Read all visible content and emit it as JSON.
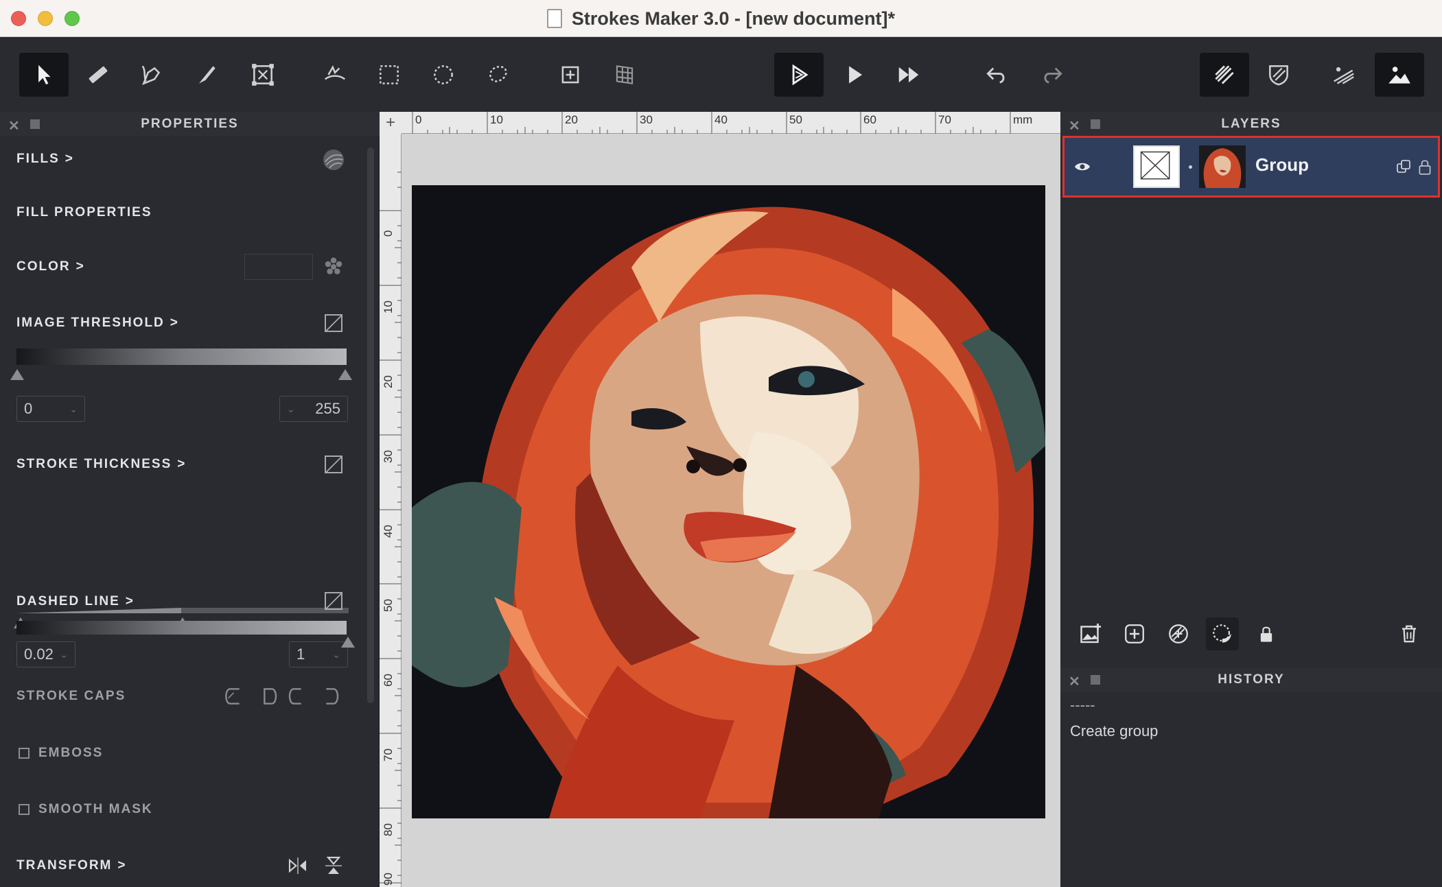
{
  "window": {
    "title": "Strokes Maker 3.0 - [new document]*"
  },
  "toolbar": {
    "tools": [
      {
        "name": "select-tool",
        "icon": "arrow-pointer-icon"
      },
      {
        "name": "ruler-tool",
        "icon": "ruler-icon"
      },
      {
        "name": "pen-tool",
        "icon": "pen-nib-icon"
      },
      {
        "name": "brush-tool",
        "icon": "brush-icon"
      },
      {
        "name": "transform-tool",
        "icon": "transform-box-icon"
      },
      {
        "name": "stroke-direction-tool",
        "icon": "hand-stroke-icon"
      },
      {
        "name": "rect-select-tool",
        "icon": "rect-select-icon"
      },
      {
        "name": "ellipse-select-tool",
        "icon": "ellipse-select-icon"
      },
      {
        "name": "lasso-tool",
        "icon": "lasso-icon"
      },
      {
        "name": "crop-tool",
        "icon": "crop-icon"
      },
      {
        "name": "grid-tool",
        "icon": "grid-warp-icon"
      },
      {
        "name": "render-button",
        "icon": "play-outline-icon"
      },
      {
        "name": "play-button",
        "icon": "play-icon"
      },
      {
        "name": "fast-forward-button",
        "icon": "fast-forward-icon"
      },
      {
        "name": "undo-button",
        "icon": "undo-icon"
      },
      {
        "name": "redo-button",
        "icon": "redo-icon"
      },
      {
        "name": "view-strokes-button",
        "icon": "strokes-view-icon"
      },
      {
        "name": "view-shield-button",
        "icon": "shield-stripes-icon"
      },
      {
        "name": "view-mixed-button",
        "icon": "landscape-strokes-icon"
      },
      {
        "name": "view-image-button",
        "icon": "landscape-image-icon"
      }
    ]
  },
  "properties": {
    "panel_title": "PROPERTIES",
    "fills_label": "FILLS",
    "fill_properties_label": "FILL PROPERTIES",
    "color_label": "COLOR",
    "image_threshold_label": "IMAGE THRESHOLD",
    "threshold_min": "0",
    "threshold_max": "255",
    "stroke_thickness_label": "STROKE THICKNESS",
    "thickness_min": "0.02",
    "thickness_max": "1",
    "dashed_line_label": "DASHED LINE",
    "stroke_caps_label": "STROKE CAPS",
    "emboss_label": "EMBOSS",
    "smooth_mask_label": "SMOOTH MASK",
    "transform_label": "TRANSFORM"
  },
  "canvas": {
    "ruler_top_labels": [
      "0",
      "10",
      "20",
      "30",
      "40",
      "50",
      "60",
      "70",
      "mm"
    ],
    "ruler_left_labels": [
      "0",
      "10",
      "20",
      "30",
      "40",
      "50",
      "60",
      "70",
      "80",
      "90"
    ],
    "artwork": "woman-portrait-strokes"
  },
  "layers": {
    "panel_title": "LAYERS",
    "items": [
      {
        "name": "Group",
        "visible": true
      }
    ]
  },
  "history": {
    "panel_title": "HISTORY",
    "separator": "-----",
    "entries": [
      "Create group"
    ]
  },
  "colors": {
    "accent_selected_layer": "#2f3e5c",
    "selection_outline": "#e0312b"
  }
}
